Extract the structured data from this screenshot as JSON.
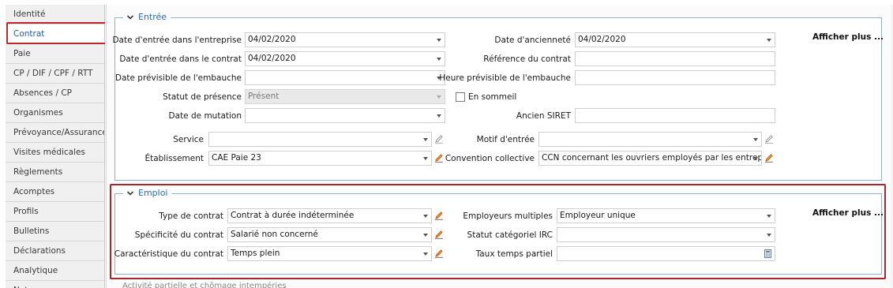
{
  "sidebar": {
    "items": [
      {
        "label": "Identité"
      },
      {
        "label": "Contrat"
      },
      {
        "label": "Paie"
      },
      {
        "label": "CP / DIF / CPF / RTT"
      },
      {
        "label": "Absences / CP"
      },
      {
        "label": "Organismes"
      },
      {
        "label": "Prévoyance/Assurance"
      },
      {
        "label": "Visites médicales"
      },
      {
        "label": "Règlements"
      },
      {
        "label": "Acomptes"
      },
      {
        "label": "Profils"
      },
      {
        "label": "Bulletins"
      },
      {
        "label": "Déclarations"
      },
      {
        "label": "Analytique"
      },
      {
        "label": "Notes"
      }
    ],
    "active": "Contrat"
  },
  "entree": {
    "title": "Entrée",
    "afficher_plus": "Afficher plus ...",
    "date_entree_entreprise": {
      "label": "Date d'entrée dans l'entreprise",
      "value": "04/02/2020"
    },
    "date_entree_contrat": {
      "label": "Date d'entrée dans le contrat",
      "value": "04/02/2020"
    },
    "date_previsible_embauche": {
      "label": "Date prévisible de l'embauche",
      "value": ""
    },
    "statut_presence": {
      "label": "Statut de présence",
      "value": "Présent"
    },
    "date_mutation": {
      "label": "Date de mutation",
      "value": ""
    },
    "service": {
      "label": "Service",
      "value": ""
    },
    "etablissement": {
      "label": "Établissement",
      "value": "CAE Paie 23"
    },
    "date_anciennete": {
      "label": "Date d'ancienneté",
      "value": "04/02/2020"
    },
    "reference_contrat": {
      "label": "Référence du contrat",
      "value": ""
    },
    "heure_previsible_embauche": {
      "label": "Heure prévisible de l'embauche",
      "value": ""
    },
    "en_sommeil": {
      "label": "En sommeil",
      "checked": false
    },
    "ancien_siret": {
      "label": "Ancien SIRET",
      "value": ""
    },
    "motif_entree": {
      "label": "Motif d'entrée",
      "value": ""
    },
    "convention_collective": {
      "label": "Convention collective",
      "value": "CCN concernant les ouvriers employés par les entrepris"
    }
  },
  "emploi": {
    "title": "Emploi",
    "afficher_plus": "Afficher plus ...",
    "type_contrat": {
      "label": "Type de contrat",
      "value": "Contrat à durée indéterminée"
    },
    "specificite_contrat": {
      "label": "Spécificité du contrat",
      "value": "Salarié non concerné"
    },
    "caracteristique_contrat": {
      "label": "Caractéristique du contrat",
      "value": "Temps plein"
    },
    "employeurs_multiples": {
      "label": "Employeurs multiples",
      "value": "Employeur unique"
    },
    "statut_categoriel_irc": {
      "label": "Statut catégoriel IRC",
      "value": ""
    },
    "taux_temps_partiel": {
      "label": "Taux temps partiel",
      "value": ""
    }
  },
  "bottom_hint": "Activité partielle et chômage intempéries",
  "colors": {
    "accent_blue": "#2a6fb6",
    "highlight_red": "#c0262d",
    "section_border": "#8fb1d4",
    "edit_orange": "#e07a1f"
  }
}
